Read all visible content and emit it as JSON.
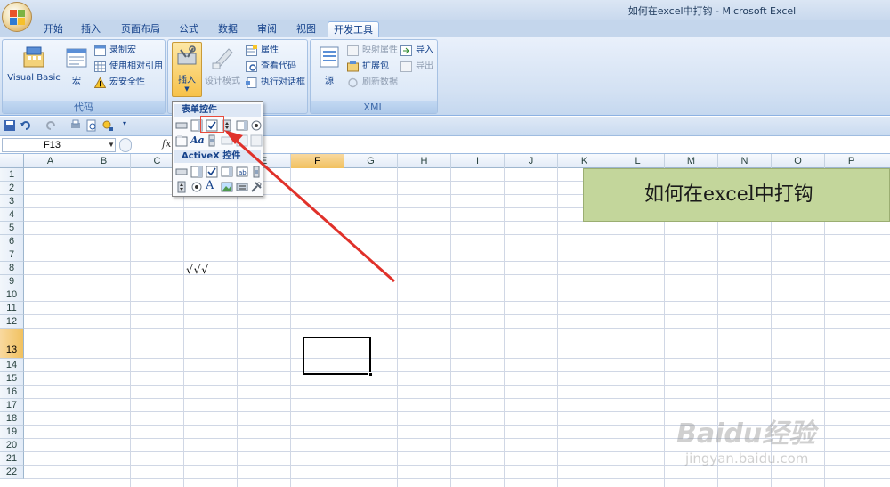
{
  "window": {
    "title": "如何在excel中打钩 - Microsoft Excel"
  },
  "tabs": [
    {
      "label": "开始",
      "active": false
    },
    {
      "label": "插入",
      "active": false
    },
    {
      "label": "页面布局",
      "active": false
    },
    {
      "label": "公式",
      "active": false
    },
    {
      "label": "数据",
      "active": false
    },
    {
      "label": "审阅",
      "active": false
    },
    {
      "label": "视图",
      "active": false
    },
    {
      "label": "开发工具",
      "active": true
    }
  ],
  "ribbon": {
    "code_group": {
      "label": "代码",
      "visual_basic": "Visual Basic",
      "macros": "宏",
      "record_macro": "录制宏",
      "relative_ref": "使用相对引用",
      "macro_security": "宏安全性"
    },
    "controls_group": {
      "insert": "插入",
      "design_mode": "设计模式",
      "properties": "属性",
      "view_code": "查看代码",
      "run_dialog": "执行对话框"
    },
    "xml_group": {
      "label": "XML",
      "source": "源",
      "map_properties": "映射属性",
      "expansion_packs": "扩展包",
      "refresh_data": "刷新数据",
      "import": "导入",
      "export": "导出"
    }
  },
  "dropdown": {
    "form_controls_header": "表单控件",
    "activex_header": "ActiveX 控件",
    "form_label_text": "Aa",
    "activex_label_text": "A"
  },
  "formula_bar": {
    "name_box": "F13",
    "fx": "fx"
  },
  "columns": [
    "A",
    "B",
    "C",
    "D",
    "E",
    "F",
    "G",
    "H",
    "I",
    "J",
    "K",
    "L",
    "M",
    "N",
    "O",
    "P"
  ],
  "rows": [
    "1",
    "2",
    "3",
    "4",
    "5",
    "6",
    "7",
    "8",
    "9",
    "10",
    "11",
    "12",
    "13",
    "14",
    "15",
    "16",
    "17",
    "18",
    "19",
    "20",
    "21",
    "22"
  ],
  "selected": {
    "column": "F",
    "row": "13"
  },
  "cells": {
    "banner": "如何在excel中打钩",
    "d8": "√√√"
  },
  "watermark": {
    "brand": "Baidu经验",
    "url": "jingyan.baidu.com"
  },
  "colors": {
    "accent_red": "#e0312a",
    "banner_bg": "#c3d69b",
    "selection_orange": "#f1c15f"
  }
}
